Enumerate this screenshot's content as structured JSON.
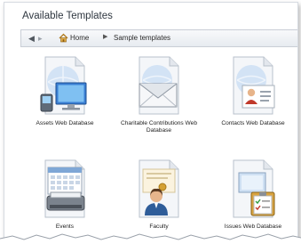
{
  "panel": {
    "title": "Available Templates"
  },
  "nav": {
    "back_icon": "back-arrow-icon",
    "forward_icon": "forward-arrow-icon",
    "home_icon": "home-icon",
    "breadcrumb": [
      "Home",
      "Sample templates"
    ]
  },
  "templates": [
    {
      "label": "Assets Web Database",
      "icon": "assets-computer-icon"
    },
    {
      "label": "Charitable Contributions Web Database",
      "icon": "envelope-icon"
    },
    {
      "label": "Contacts Web Database",
      "icon": "contact-card-icon"
    },
    {
      "label": "Events",
      "icon": "calendar-printer-icon"
    },
    {
      "label": "Faculty",
      "icon": "faculty-person-icon"
    },
    {
      "label": "Issues Web Database",
      "icon": "issues-checklist-icon"
    }
  ]
}
